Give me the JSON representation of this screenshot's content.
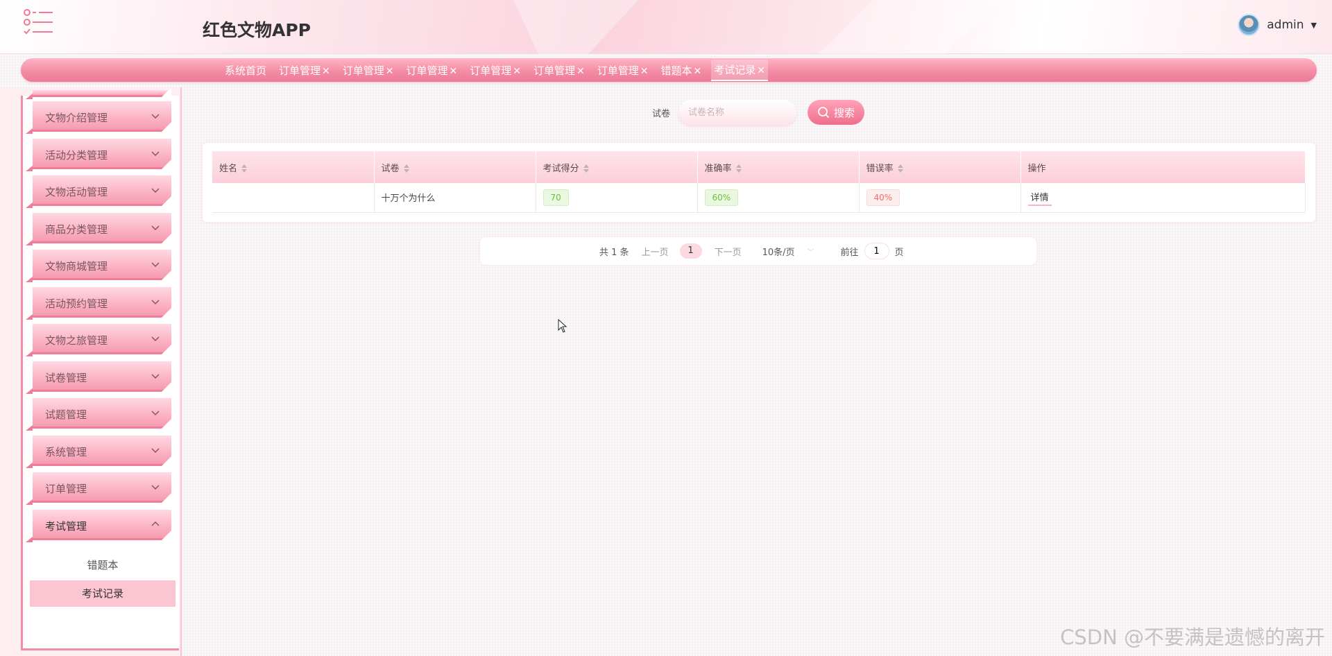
{
  "header": {
    "app_title": "红色文物APP",
    "username": "admin",
    "menu_icon": "menu-list-icon",
    "avatar_icon": "user-avatar-icon",
    "caret": "▼"
  },
  "tabs": [
    {
      "label": "系统首页",
      "closable": false,
      "active": false
    },
    {
      "label": "订单管理",
      "closable": true,
      "active": false
    },
    {
      "label": "订单管理",
      "closable": true,
      "active": false
    },
    {
      "label": "订单管理",
      "closable": true,
      "active": false
    },
    {
      "label": "订单管理",
      "closable": true,
      "active": false
    },
    {
      "label": "订单管理",
      "closable": true,
      "active": false
    },
    {
      "label": "订单管理",
      "closable": true,
      "active": false
    },
    {
      "label": "错题本",
      "closable": true,
      "active": false
    },
    {
      "label": "考试记录",
      "closable": true,
      "active": true
    }
  ],
  "tab_close_glyph": "✕",
  "sidebar": {
    "items": [
      {
        "label": "文物介绍管理",
        "open": false
      },
      {
        "label": "活动分类管理",
        "open": false
      },
      {
        "label": "文物活动管理",
        "open": false
      },
      {
        "label": "商品分类管理",
        "open": false
      },
      {
        "label": "文物商城管理",
        "open": false
      },
      {
        "label": "活动预约管理",
        "open": false
      },
      {
        "label": "文物之旅管理",
        "open": false
      },
      {
        "label": "试卷管理",
        "open": false
      },
      {
        "label": "试题管理",
        "open": false
      },
      {
        "label": "系统管理",
        "open": false
      },
      {
        "label": "订单管理",
        "open": false
      },
      {
        "label": "考试管理",
        "open": true
      }
    ],
    "submenu": [
      {
        "label": "错题本",
        "active": false
      },
      {
        "label": "考试记录",
        "active": true
      }
    ]
  },
  "search": {
    "label": "试卷",
    "placeholder": "试卷名称",
    "value": "",
    "button_label": "搜索"
  },
  "table": {
    "columns": [
      "姓名",
      "试卷",
      "考试得分",
      "准确率",
      "错误率",
      "操作"
    ],
    "rows": [
      {
        "name": "",
        "paper": "十万个为什么",
        "score": "70",
        "accuracy": "60%",
        "error_rate": "40%",
        "action": "详情"
      }
    ]
  },
  "pagination": {
    "total": "共 1 条",
    "prev": "上一页",
    "current": "1",
    "next": "下一页",
    "page_size": "10条/页",
    "goto_label": "前往",
    "goto_value": "1",
    "goto_suffix": "页"
  },
  "watermark": "CSDN @不要满是遗憾的离开",
  "colors": {
    "accent": "#f48ca6",
    "tab_bar": "#ef7d99",
    "success": "#67c23a",
    "danger": "#f56c6c"
  }
}
